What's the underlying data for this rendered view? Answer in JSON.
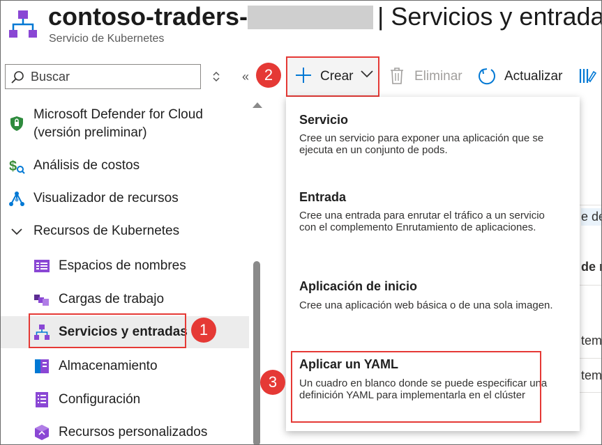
{
  "header": {
    "title_bold": "contoso-traders-",
    "title_rest": "| Servicios y entradas",
    "subtitle": "Servicio de Kubernetes"
  },
  "search": {
    "placeholder": "Buscar"
  },
  "sidebar": {
    "items": [
      {
        "label": "Microsoft Defender for Cloud",
        "label2": "(versión preliminar)"
      },
      {
        "label": "Análisis de costos"
      },
      {
        "label": "Visualizador de recursos"
      },
      {
        "label": "Recursos de Kubernetes"
      },
      {
        "label": "Espacios de nombres"
      },
      {
        "label": "Cargas de trabajo"
      },
      {
        "label": "Servicios y entradas"
      },
      {
        "label": "Almacenamiento"
      },
      {
        "label": "Configuración"
      },
      {
        "label": "Recursos personalizados"
      }
    ]
  },
  "toolbar": {
    "create_label": "Crear",
    "delete_label": "Eliminar",
    "refresh_label": "Actualizar"
  },
  "badges": [
    "1",
    "2",
    "3"
  ],
  "background": {
    "frag1": "e de",
    "frag2": "de n",
    "frag3": "tem",
    "frag4": "tem"
  },
  "dropdown": {
    "items": [
      {
        "title": "Servicio",
        "desc": "Cree un servicio para exponer una aplicación que se ejecuta en un conjunto de pods."
      },
      {
        "title": "Entrada",
        "desc": "Cree una entrada para enrutar el tráfico a un servicio con el complemento Enrutamiento de aplicaciones."
      },
      {
        "title": "Aplicación de inicio",
        "desc": "Cree una aplicación web básica o de una sola imagen."
      },
      {
        "title": "Aplicar un YAML",
        "desc": "Un cuadro en blanco donde se puede especificar una definición YAML para implementarla en el clúster"
      }
    ]
  },
  "colors": {
    "accent": "#0078d4",
    "highlight": "#e53935",
    "kube_purple": "#7a3ec8"
  }
}
